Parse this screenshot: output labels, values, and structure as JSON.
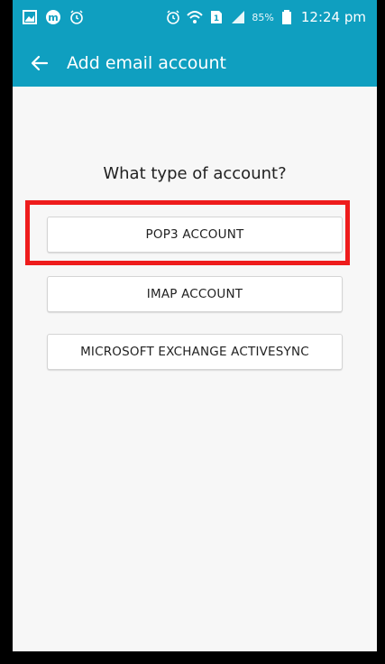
{
  "status_bar": {
    "left_icons": [
      "gallery-icon",
      "messenger-icon",
      "alarm-icon"
    ],
    "right_icons": [
      "alarm-icon",
      "wifi-icon",
      "sim-icon",
      "signal-icon"
    ],
    "battery_percent": "85%",
    "time": "12:24 pm"
  },
  "app_bar": {
    "back_icon": "arrow-left-icon",
    "title": "Add email account"
  },
  "main": {
    "question": "What type of account?",
    "options": [
      {
        "label": "POP3 ACCOUNT"
      },
      {
        "label": "IMAP ACCOUNT"
      },
      {
        "label": "MICROSOFT EXCHANGE ACTIVESYNC"
      }
    ]
  },
  "colors": {
    "accent": "#0f9fc0",
    "highlight": "#ee1c1c",
    "background": "#f7f7f7"
  }
}
